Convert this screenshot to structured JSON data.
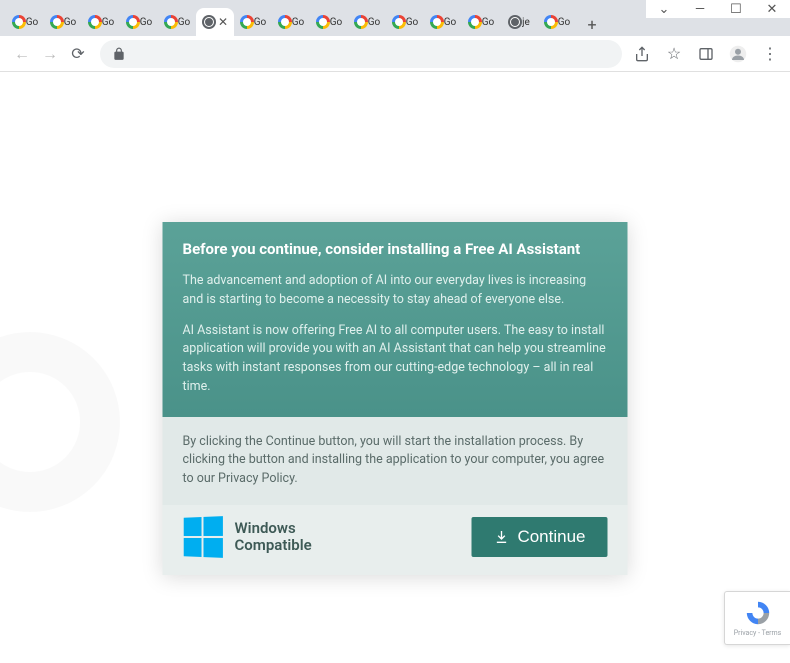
{
  "window": {
    "minimize": "—",
    "maximize": "☐",
    "close": "✕",
    "down": "⌄"
  },
  "tabs": [
    {
      "favicon": "google",
      "label": "Go"
    },
    {
      "favicon": "google",
      "label": "Go"
    },
    {
      "favicon": "google",
      "label": "Go"
    },
    {
      "favicon": "google",
      "label": "Go"
    },
    {
      "favicon": "google",
      "label": "Go"
    },
    {
      "favicon": "globe",
      "label": "",
      "active": true
    },
    {
      "favicon": "google",
      "label": "Go"
    },
    {
      "favicon": "google",
      "label": "Go"
    },
    {
      "favicon": "google",
      "label": "Go"
    },
    {
      "favicon": "google",
      "label": "Go"
    },
    {
      "favicon": "google",
      "label": "Go"
    },
    {
      "favicon": "google",
      "label": "Go"
    },
    {
      "favicon": "google",
      "label": "Go"
    },
    {
      "favicon": "globe",
      "label": "je"
    },
    {
      "favicon": "google",
      "label": "Go"
    }
  ],
  "modal": {
    "title": "Before you continue, consider installing a Free AI Assistant",
    "para1": "The advancement and adoption of AI into our everyday lives is increasing and is starting to become a necessity to stay ahead of everyone else.",
    "para2": "AI Assistant is now offering Free AI to all computer users. The easy to install application will provide you with an AI Assistant that can help you streamline tasks with instant responses from our cutting-edge technology – all in real time.",
    "disclaimer": "By clicking the Continue button, you will start the installation process. By clicking the button and installing the application to your computer, you agree to our Privacy Policy.",
    "compat_line1": "Windows",
    "compat_line2": "Compatible",
    "continue_label": "Continue"
  },
  "recaptcha": {
    "line": "Privacy - Terms"
  }
}
